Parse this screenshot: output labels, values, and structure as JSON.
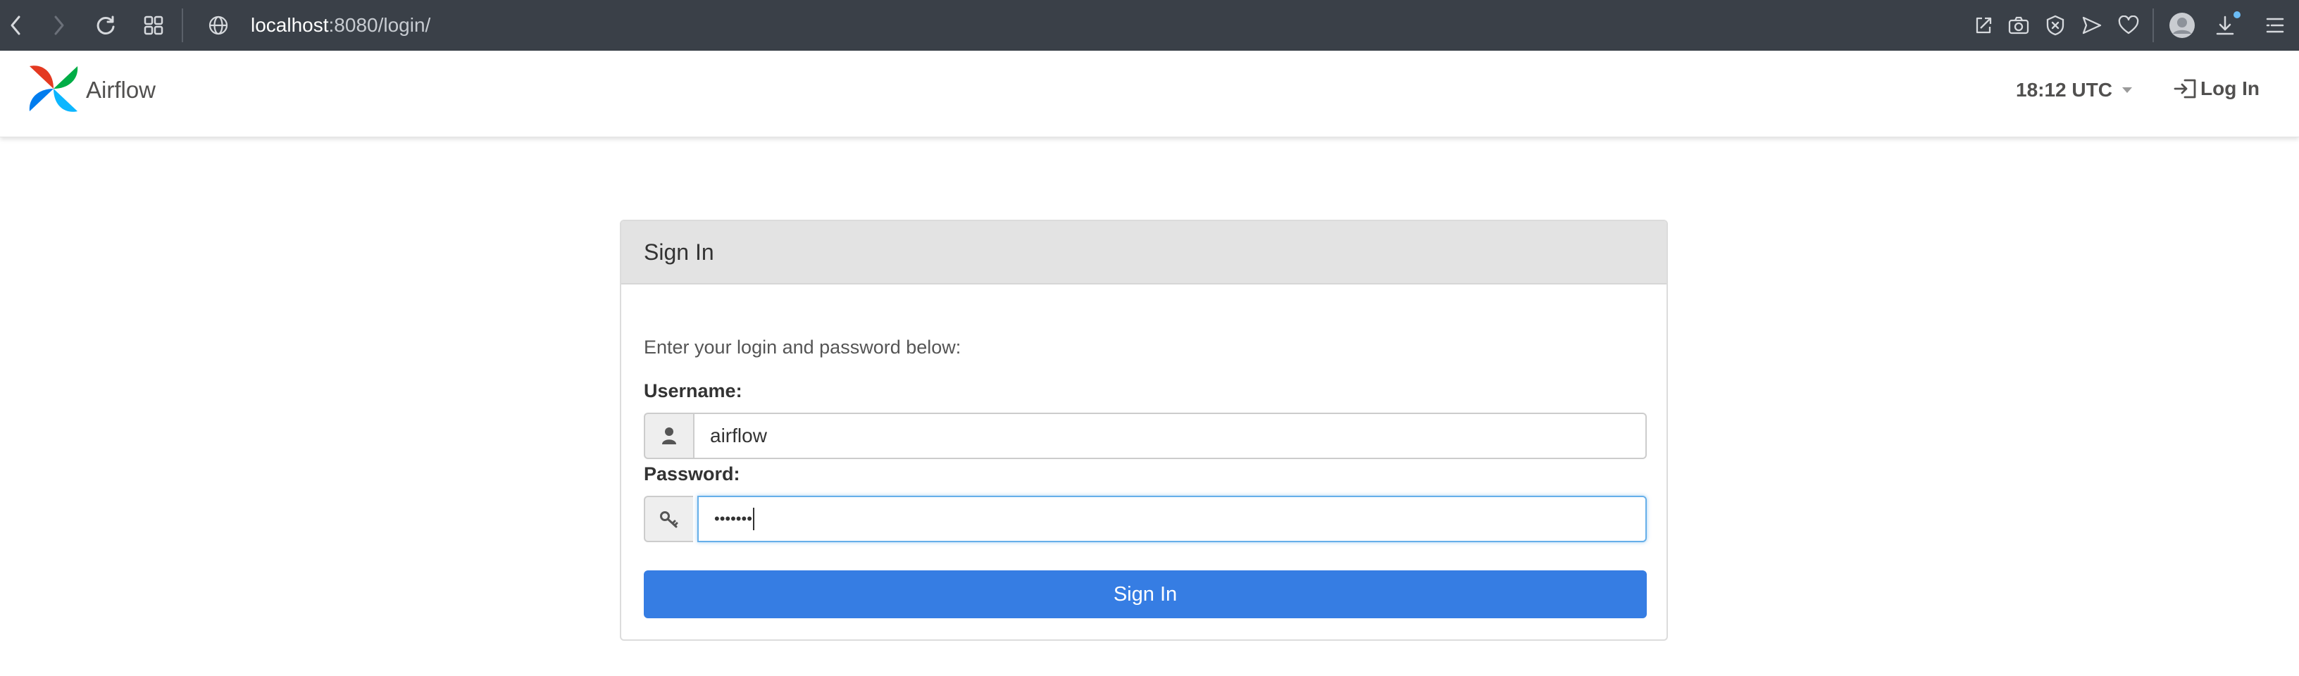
{
  "browser": {
    "url_host": "localhost",
    "url_path": ":8080/login/"
  },
  "navbar": {
    "brand": "Airflow",
    "clock": "18:12 UTC",
    "login_label": "Log In"
  },
  "panel": {
    "title": "Sign In",
    "intro": "Enter your login and password below:",
    "username_label": "Username:",
    "username_value": "airflow",
    "password_label": "Password:",
    "password_value": "•••••••",
    "submit_label": "Sign In"
  },
  "colors": {
    "chrome": "#3a4048",
    "primary": "#367de3",
    "focus": "#66afe9"
  }
}
